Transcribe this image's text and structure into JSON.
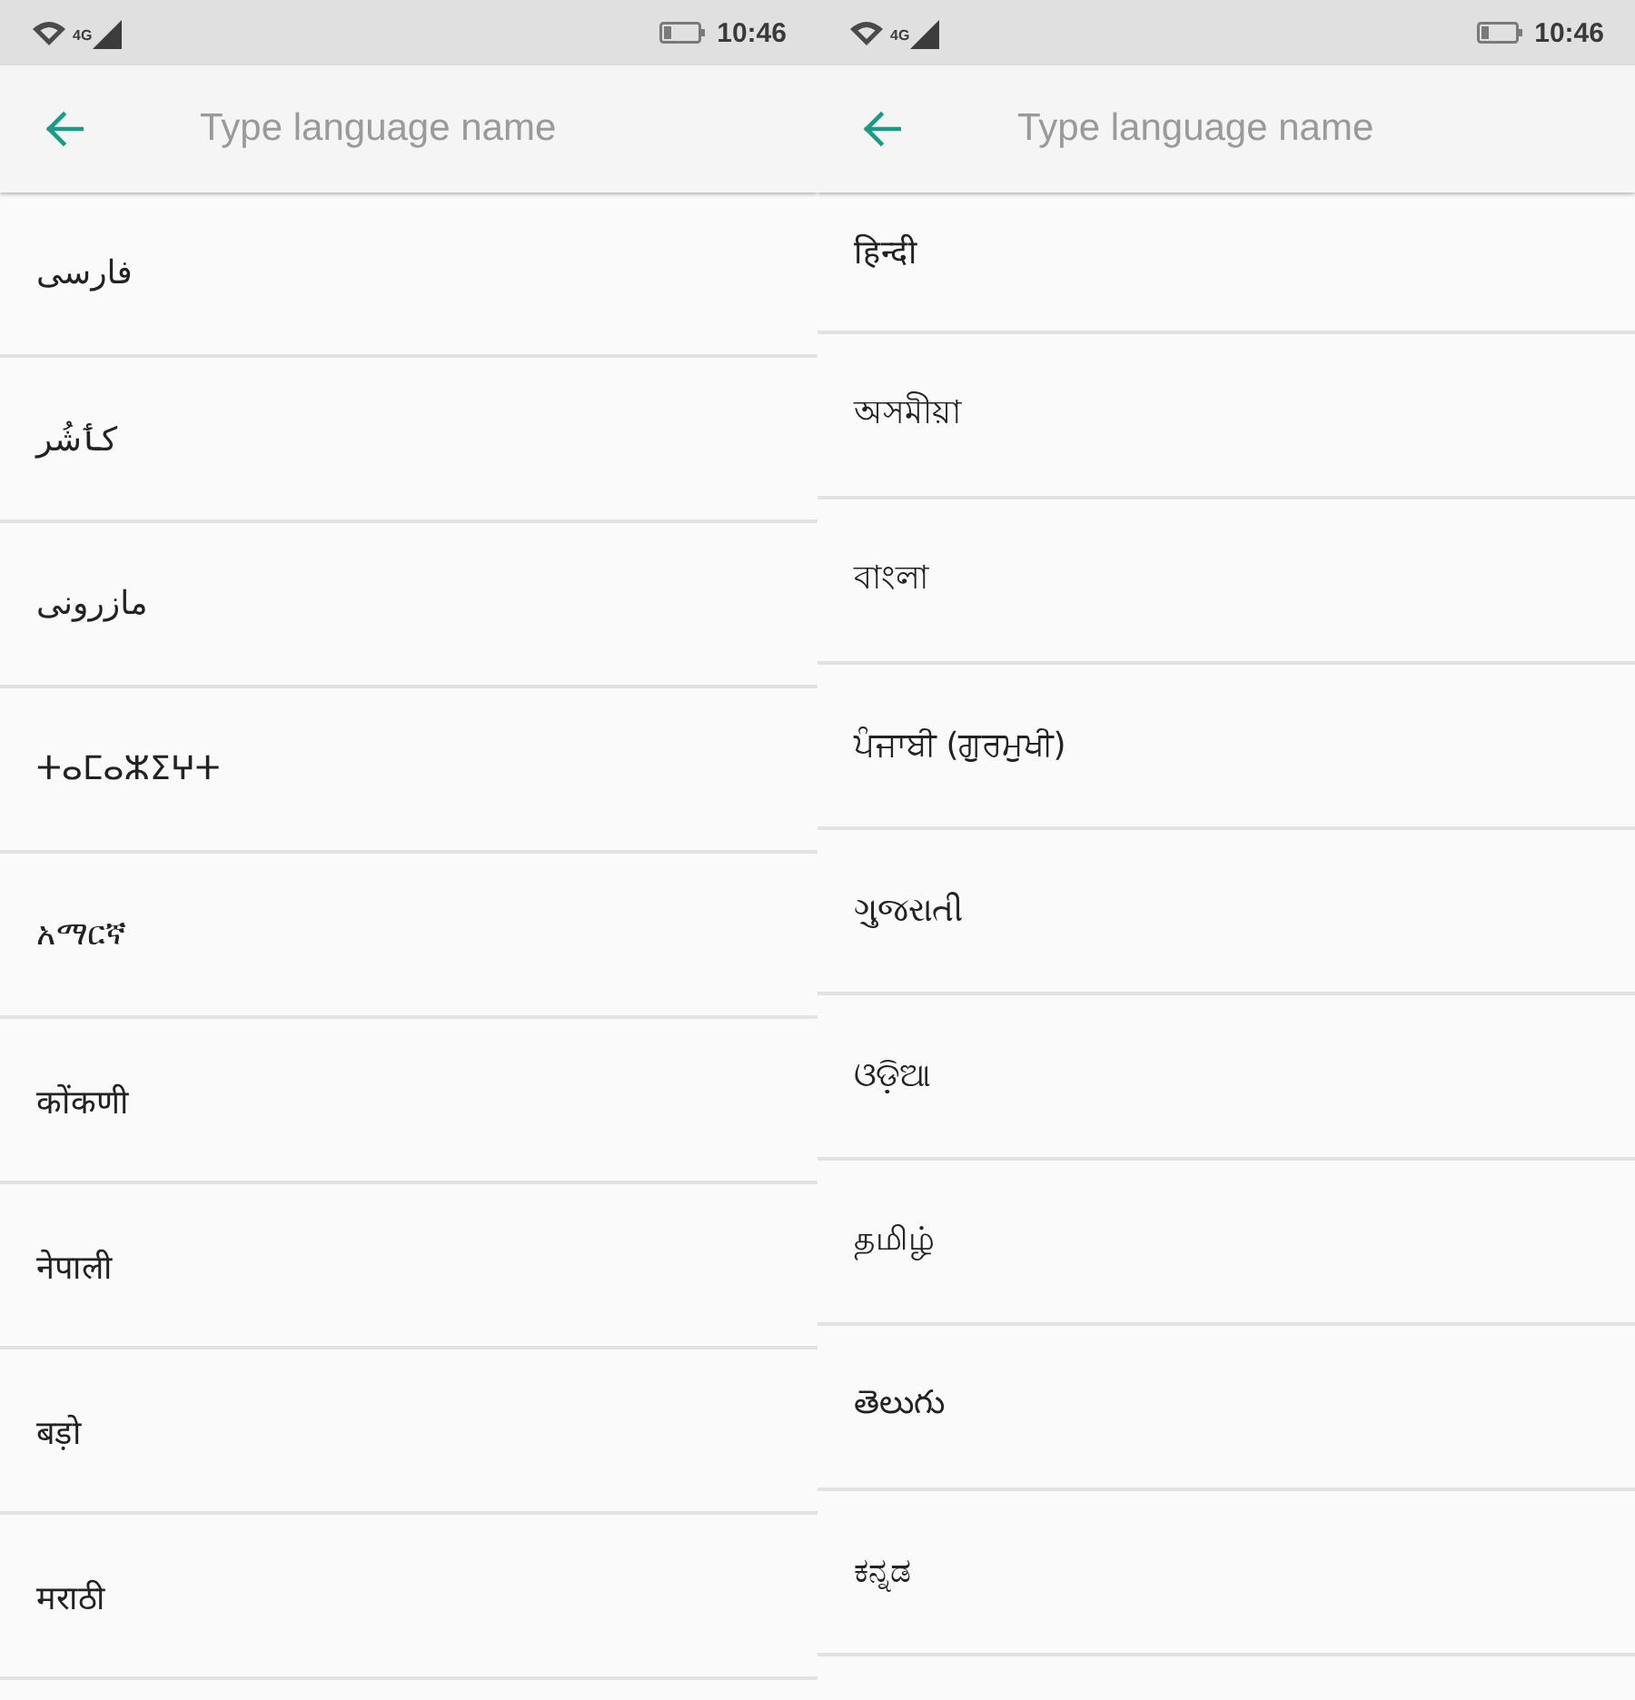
{
  "screens": [
    {
      "status_bar": {
        "network_type": "4G",
        "time": "10:46"
      },
      "search": {
        "placeholder": "Type language name"
      },
      "languages": [
        {
          "name": "فارسی"
        },
        {
          "name": "کٲشُر"
        },
        {
          "name": "مازرونی"
        },
        {
          "name": "ⵜⴰⵎⴰⵣⵉⵖⵜ"
        },
        {
          "name": "አማርኛ"
        },
        {
          "name": "कोंकणी"
        },
        {
          "name": "नेपाली"
        },
        {
          "name": "बड़ो"
        },
        {
          "name": "मराठी"
        }
      ]
    },
    {
      "status_bar": {
        "network_type": "4G",
        "time": "10:46"
      },
      "search": {
        "placeholder": "Type language name"
      },
      "languages": [
        {
          "name": "हिन्दी"
        },
        {
          "name": "অসমীয়া"
        },
        {
          "name": "বাংলা"
        },
        {
          "name": "ਪੰਜਾਬੀ (ਗੁਰਮੁਖੀ)"
        },
        {
          "name": "ગુજરાતી"
        },
        {
          "name": "ଓଡ଼ିଆ"
        },
        {
          "name": "தமிழ்"
        },
        {
          "name": "తెలుగు"
        },
        {
          "name": "ಕನ್ನಡ"
        }
      ]
    }
  ]
}
